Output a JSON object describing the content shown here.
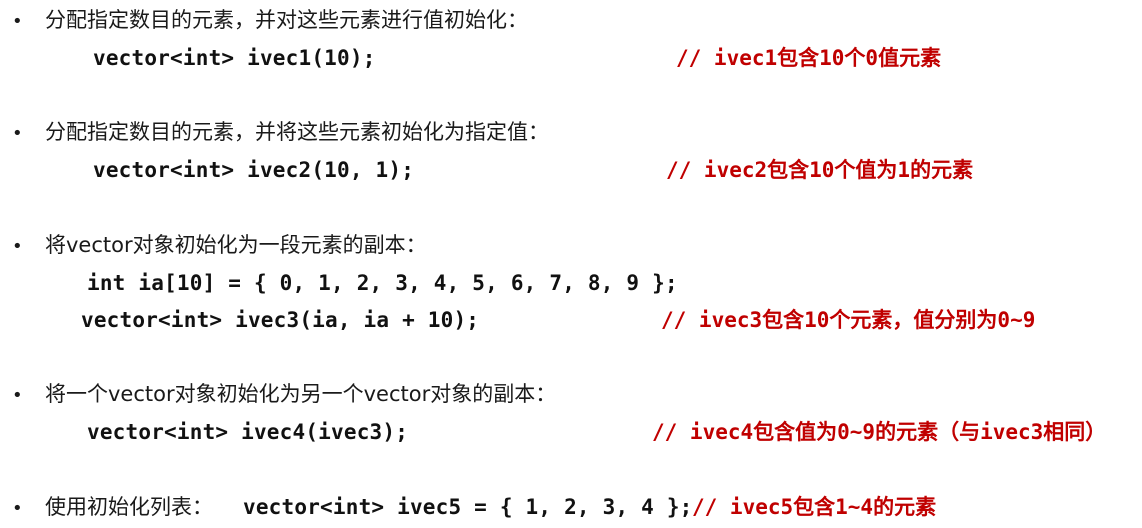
{
  "bullet_char": "•",
  "items": [
    {
      "text": "分配指定数目的元素，并对这些元素进行值初始化：",
      "code_lines": [
        {
          "code": "vector<int> ivec1(10);",
          "comment": "// ivec1包含10个0值元素"
        }
      ]
    },
    {
      "text": "分配指定数目的元素，并将这些元素初始化为指定值：",
      "code_lines": [
        {
          "code": "vector<int> ivec2(10, 1);",
          "comment": "// ivec2包含10个值为1的元素"
        }
      ]
    },
    {
      "text": "将vector对象初始化为一段元素的副本：",
      "code_lines": [
        {
          "code": "int ia[10] = { 0, 1, 2, 3, 4, 5, 6, 7, 8, 9 };",
          "comment": ""
        },
        {
          "code": "vector<int> ivec3(ia, ia + 10);",
          "comment": "// ivec3包含10个元素，值分别为0~9"
        }
      ]
    },
    {
      "text": "将一个vector对象初始化为另一个vector对象的副本：",
      "code_lines": [
        {
          "code": "vector<int> ivec4(ivec3);",
          "comment": "// ivec4包含值为0~9的元素（与ivec3相同）"
        }
      ]
    },
    {
      "text": "使用初始化列表：",
      "inline_code": "vector<int> ivec5 = { 1, 2, 3, 4 };",
      "inline_comment": "// ivec5包含1~4的元素"
    }
  ],
  "colors": {
    "text": "#1a1a1a",
    "comment": "#c00000",
    "background": "#ffffff"
  }
}
